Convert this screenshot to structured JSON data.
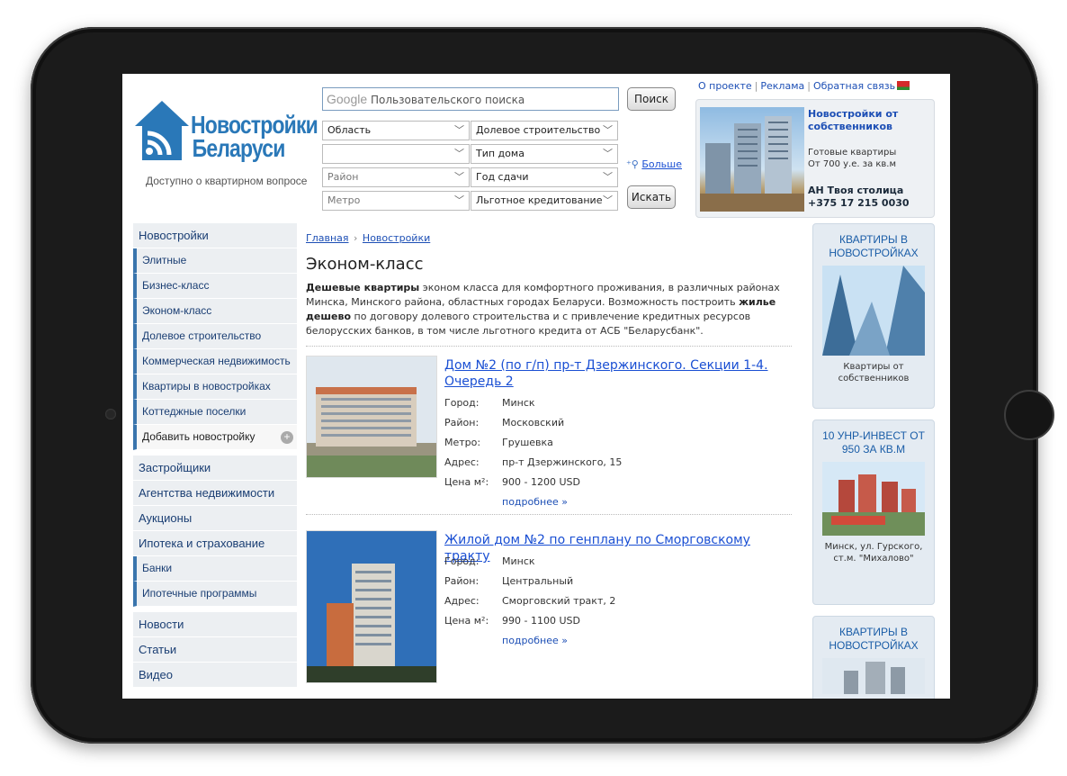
{
  "header": {
    "logo_line1": "Новостройки",
    "logo_line2": "Беларуси",
    "logo_tagline": "Доступно о квартирном вопросе",
    "search_google": "Google",
    "search_placeholder": "Пользовательского поиска",
    "search_button": "Поиск",
    "find_button": "Искать",
    "more_link": "Больше",
    "filters": {
      "region": "Область",
      "shared_construction": "Долевое строительство",
      "empty": "",
      "house_type": "Тип дома",
      "district": "Район",
      "delivery_year": "Год сдачи",
      "metro": "Метро",
      "preferential_credit": "Льготное кредитование"
    },
    "top_links": [
      "О проекте",
      "Реклама",
      "Обратная связь"
    ]
  },
  "ad_top": {
    "title": "Новостройки от собственников",
    "line1": "Готовые квартиры",
    "line2": "От 700 у.е. за кв.м",
    "agency": "АН Твоя столица",
    "phone": "+375 17 215 0030"
  },
  "sidebar": {
    "group1": [
      {
        "label": "Новостройки",
        "sub": false
      },
      {
        "label": "Элитные",
        "sub": true
      },
      {
        "label": "Бизнес-класс",
        "sub": true
      },
      {
        "label": "Эконом-класс",
        "sub": true
      },
      {
        "label": "Долевое строительство",
        "sub": true
      },
      {
        "label": "Коммерческая недвижимость",
        "sub": true
      },
      {
        "label": "Квартиры в новостройках",
        "sub": true
      },
      {
        "label": "Коттеджные поселки",
        "sub": true
      },
      {
        "label": "Добавить новостройку",
        "sub": true
      }
    ],
    "group2": [
      {
        "label": "Застройщики"
      },
      {
        "label": "Агентства недвижимости"
      },
      {
        "label": "Аукционы"
      },
      {
        "label": "Ипотека и страхование"
      },
      {
        "label": "Банки"
      },
      {
        "label": "Ипотечные программы"
      }
    ],
    "group3": [
      {
        "label": "Новости"
      },
      {
        "label": "Статьи"
      },
      {
        "label": "Видео"
      }
    ]
  },
  "main": {
    "breadcrumb_home": "Главная",
    "breadcrumb_sep": "›",
    "breadcrumb_section": "Новостройки",
    "title": "Эконом-класс",
    "intro_bold1": "Дешевые квартиры",
    "intro_text1": " эконом класса для комфортного проживания, в различных районах Минска, Минского района, областных городах Беларуси. Возможность построить ",
    "intro_bold2": "жилье дешево",
    "intro_text2": " по договору долевого строительства и с привлечение кредитных ресурсов белорусских банков, в том числе льготного кредита от АСБ \"Беларусбанк\".",
    "labels": {
      "city": "Город:",
      "district": "Район:",
      "metro": "Метро:",
      "address": "Адрес:",
      "price": "Цена м²:"
    },
    "listings": [
      {
        "title": "Дом №2 (по г/п) пр-т Дзержинского. Секции 1-4. Очередь 2",
        "city": "Минск",
        "district": "Московский",
        "metro": "Грушевка",
        "address": "пр-т Дзержинского, 15",
        "price": "900 - 1200 USD",
        "more": "подробнее »"
      },
      {
        "title": "Жилой дом №2 по генплану по Сморговскому тракту",
        "city": "Минск",
        "district": "Центральный",
        "address": "Сморговский тракт, 2",
        "price": "990 - 1100 USD",
        "more": "подробнее »"
      }
    ]
  },
  "right_ads": [
    {
      "title": "КВАРТИРЫ В НОВОСТРОЙКАХ",
      "caption": "Квартиры от собственников"
    },
    {
      "title": "10 УНР-ИНВЕСТ ОТ 950 ЗА КВ.М",
      "caption": "Минск, ул. Гурского, ст.м. \"Михалово\""
    },
    {
      "title": "КВАРТИРЫ В НОВОСТРОЙКАХ",
      "caption": ""
    }
  ],
  "colors": {
    "link": "#1a4fd3",
    "nav_text": "#1a3e73",
    "brand_blue": "#2a78b8",
    "frame": "#1b1b1b"
  }
}
